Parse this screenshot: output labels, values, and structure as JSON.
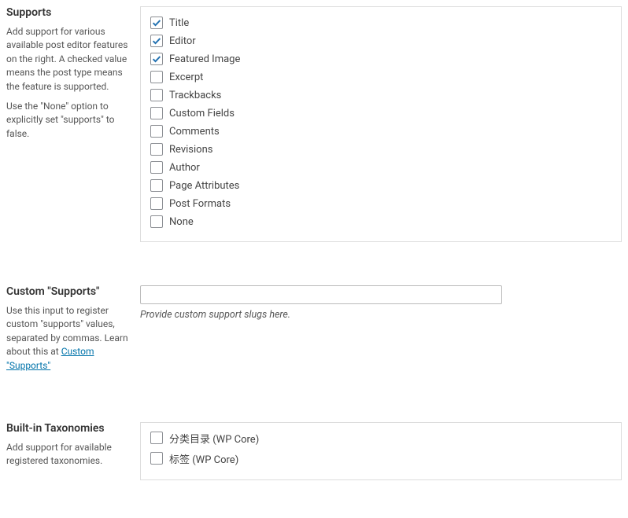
{
  "supports": {
    "heading": "Supports",
    "desc1": "Add support for various available post editor features on the right. A checked value means the post type means the feature is supported.",
    "desc2": "Use the \"None\" option to explicitly set \"supports\" to false.",
    "options": [
      {
        "label": "Title",
        "checked": true
      },
      {
        "label": "Editor",
        "checked": true
      },
      {
        "label": "Featured Image",
        "checked": true
      },
      {
        "label": "Excerpt",
        "checked": false
      },
      {
        "label": "Trackbacks",
        "checked": false
      },
      {
        "label": "Custom Fields",
        "checked": false
      },
      {
        "label": "Comments",
        "checked": false
      },
      {
        "label": "Revisions",
        "checked": false
      },
      {
        "label": "Author",
        "checked": false
      },
      {
        "label": "Page Attributes",
        "checked": false
      },
      {
        "label": "Post Formats",
        "checked": false
      },
      {
        "label": "None",
        "checked": false
      }
    ]
  },
  "custom_supports": {
    "heading": "Custom \"Supports\"",
    "desc_pre": "Use this input to register custom \"supports\" values, separated by commas. Learn about this at ",
    "link_text": "Custom \"Supports\"",
    "input_value": "",
    "hint": "Provide custom support slugs here."
  },
  "taxonomies": {
    "heading": "Built-in Taxonomies",
    "desc": "Add support for available registered taxonomies.",
    "options": [
      {
        "label": "分类目录 (WP Core)",
        "checked": false
      },
      {
        "label": "标签 (WP Core)",
        "checked": false
      }
    ]
  }
}
